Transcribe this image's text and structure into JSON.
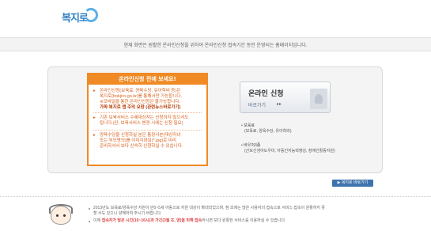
{
  "brand": {
    "logo_text": "복지로"
  },
  "notice": {
    "text": "현재 화면은 원활한 온라인신청을 위하여 온라인신청 접속기간 동안 운영되는 홈페이지입니다."
  },
  "left_panel": {
    "title": "온라인신청 전에 보세요!",
    "bullets": [
      {
        "lines": [
          "온라인신청(보육료, 양육수당, 유아학비 등)은",
          "복지로(bokjiro.go.kr)를 통해서만 가능합니다.",
          "※모바일을 통한 온라인신청은 불가능합니다.",
          "가짜 복지로 앱 주의 요망 (관련뉴스바로가기)"
        ]
      },
      {
        "lines": [
          "기존 보육서비스 수혜대상자는 신청하지 않으셔도",
          "됩니다.(단, 보육서비스 변경 시에는 신청 필요)"
        ]
      },
      {
        "lines": [
          "양육수당을 신청하실 분은 통장사본(대상자녀",
          "또는 부모명의)를 이미지화일(*.jpg)로 미리",
          "준비하셔서 보다 신속히 신청하실 수 있습니다."
        ]
      }
    ]
  },
  "apply": {
    "title": "온라인 신청",
    "sub": "바로가기",
    "arrow": "▸▸"
  },
  "info": [
    {
      "label": "보육료",
      "detail": "(보육료, 양육수당, 유아학비)"
    },
    {
      "label": "바우처3종",
      "detail": "(산모신생아도우미, 아동인지능력향상, 장애인활동지원)"
    }
  ],
  "site_button": "▶ 복지로 바로가기",
  "footer": {
    "line1": "2013년도 보육료/양육수당 지원이 만0~5세 아동으로 지원 대상이 확대되었으며, 첨 초에는 많은 사용자의 접속으로 서비스 접속이 원활하지 못",
    "line1b": "할 수도 있으니 양해하여 주시기 바랍니다.",
    "line2_pre": "이에 ",
    "line2_red": "접속자가 많은 시간(10~16시)과 가긴(3월 초, 양)을 피해 접속",
    "line2_post": "하시면 보다 원활한 서비스를 이용하실 수 있습니다."
  },
  "colors": {
    "accent": "#f08a24",
    "brand_blue": "#2d7fc4",
    "button_blue": "#3e74ad"
  }
}
